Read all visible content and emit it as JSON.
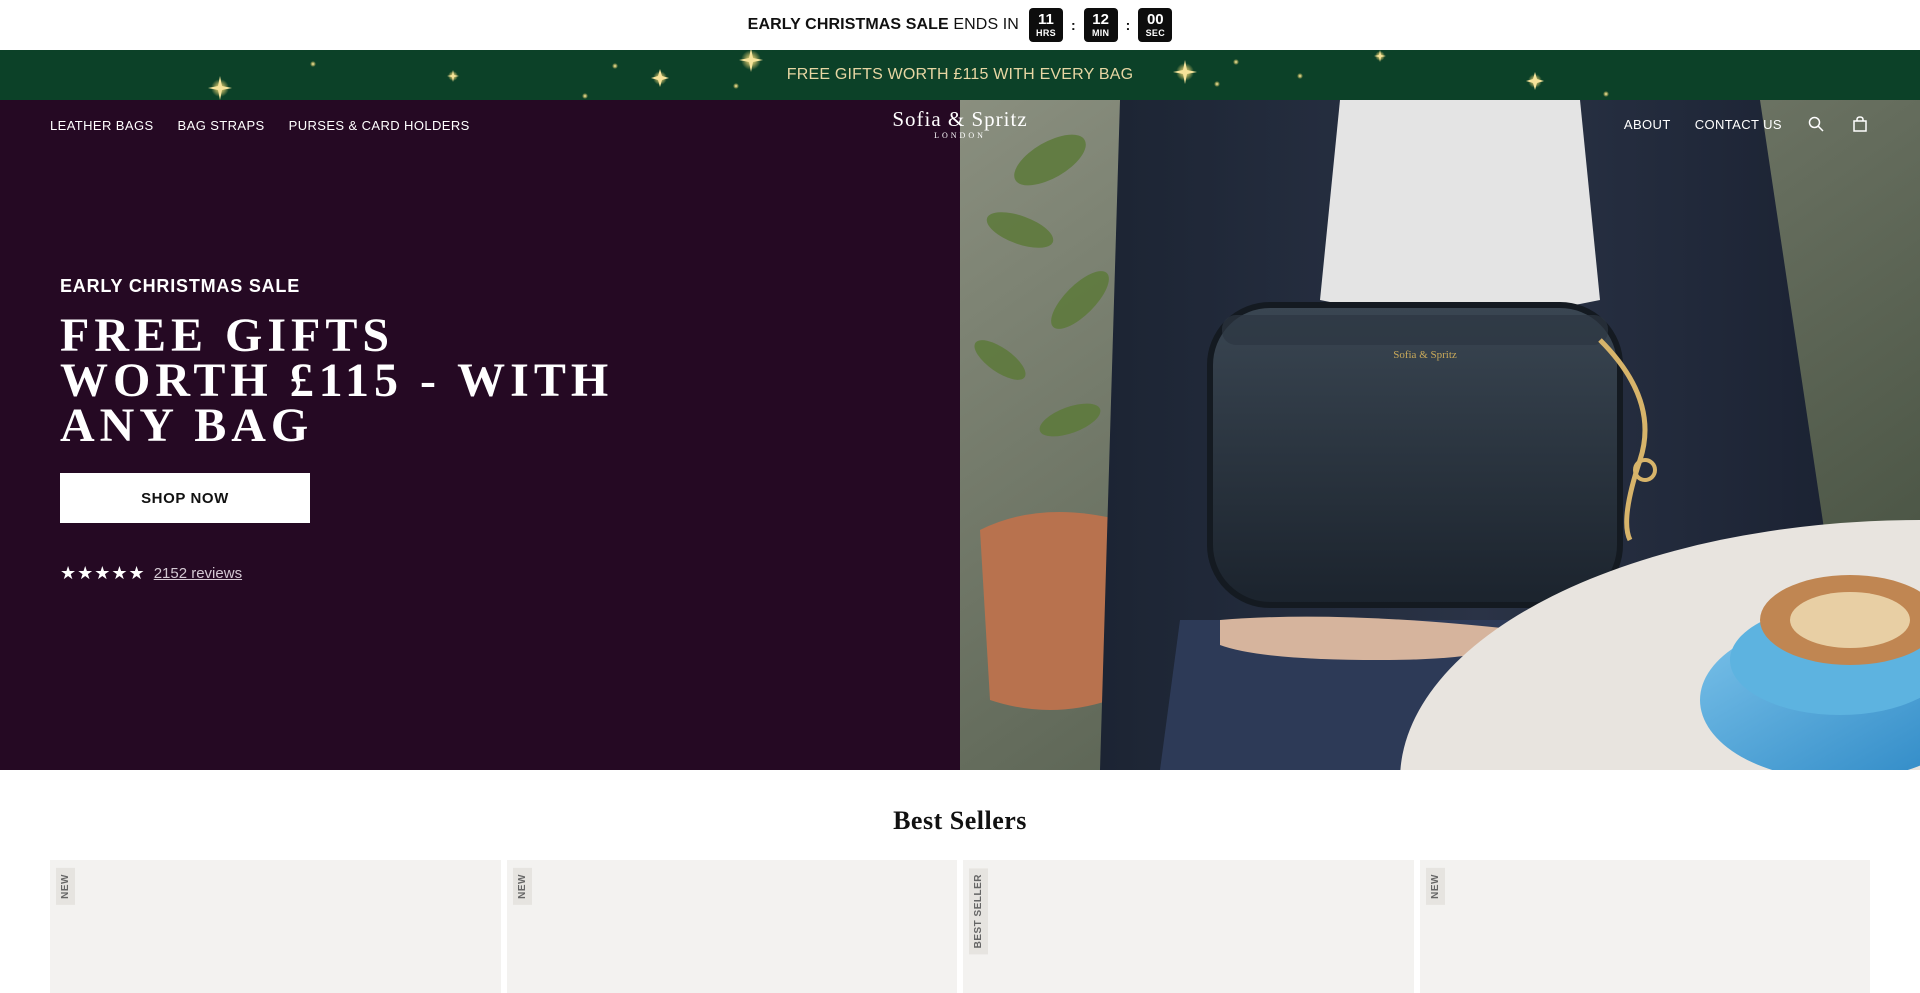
{
  "countdown": {
    "label_bold": "EARLY CHRISTMAS SALE",
    "label_rest": " ENDS IN",
    "hours": "11",
    "hours_unit": "HRS",
    "minutes": "12",
    "minutes_unit": "MIN",
    "seconds": "00",
    "seconds_unit": "SEC",
    "separator": ":"
  },
  "promo": {
    "text": "FREE GIFTS WORTH £115 WITH EVERY BAG",
    "bg_color": "#0c4128",
    "text_color": "#e7d6a3"
  },
  "nav": {
    "left": [
      "LEATHER BAGS",
      "BAG STRAPS",
      "PURSES & CARD HOLDERS"
    ],
    "logo_main": "Sofia & Spritz",
    "logo_sub": "LONDON",
    "right": [
      "ABOUT",
      "CONTACT US"
    ],
    "icons": [
      "search-icon",
      "bag-icon"
    ]
  },
  "hero": {
    "eyebrow": "EARLY CHRISTMAS SALE",
    "title": "FREE GIFTS WORTH £115 - WITH ANY BAG",
    "cta": "SHOP NOW",
    "stars": "★★★★★",
    "reviews": "2152 reviews",
    "bg_color": "#250923"
  },
  "bestsellers": {
    "title": "Best Sellers",
    "products": [
      {
        "badge": "NEW"
      },
      {
        "badge": "NEW"
      },
      {
        "badge": "BEST SELLER"
      },
      {
        "badge": "NEW"
      }
    ]
  }
}
